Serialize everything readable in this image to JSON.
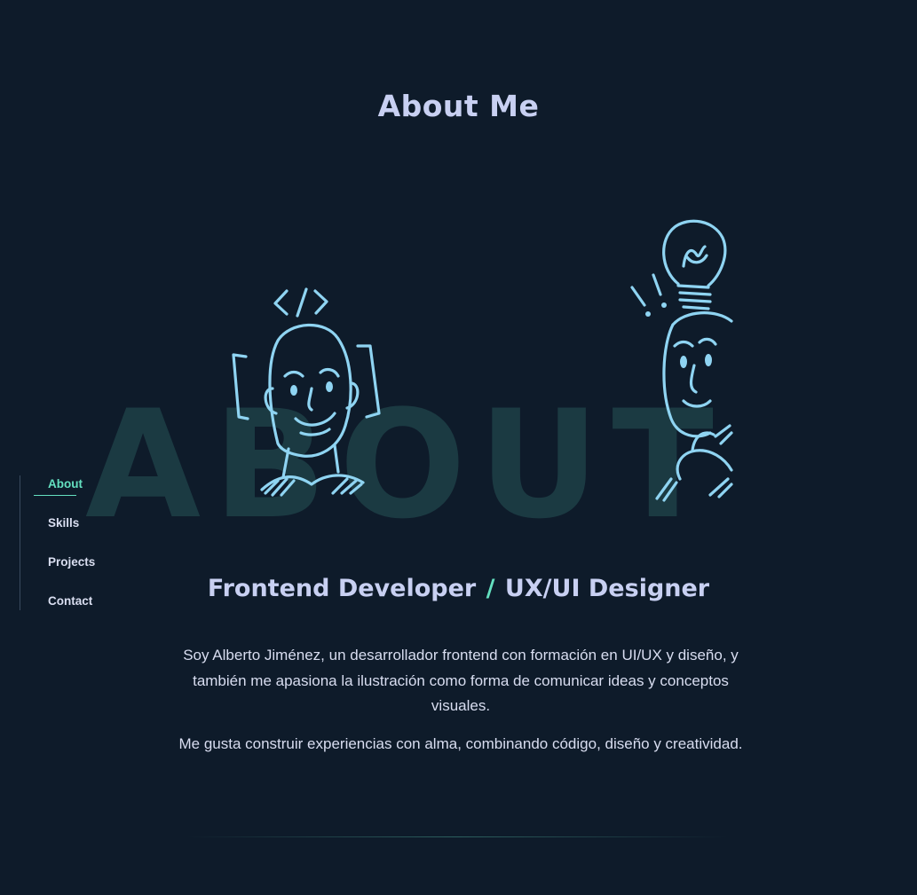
{
  "about": {
    "title": "About Me",
    "watermark": "ABOUT",
    "illustrations": {
      "left": "developer-sketch-icon",
      "right": "idea-sketch-icon"
    },
    "role": {
      "primary": "Frontend Developer",
      "separator": "/",
      "secondary": "UX/UI Designer"
    },
    "bio": [
      "Soy Alberto Jiménez, un desarrollador frontend con formación en UI/UX y diseño, y también me apasiona la ilustración como forma de comunicar ideas y conceptos visuales.",
      "Me gusta construir experiencias con alma, combinando código, diseño y creatividad."
    ]
  },
  "nav": {
    "items": [
      {
        "label": "About",
        "active": true
      },
      {
        "label": "Skills",
        "active": false
      },
      {
        "label": "Projects",
        "active": false
      },
      {
        "label": "Contact",
        "active": false
      }
    ]
  },
  "colors": {
    "background": "#0e1b2a",
    "accent": "#64e0c0",
    "heading": "#c8d0f2",
    "sketch": "#8fd4f2",
    "watermark": "#1b3a42"
  }
}
